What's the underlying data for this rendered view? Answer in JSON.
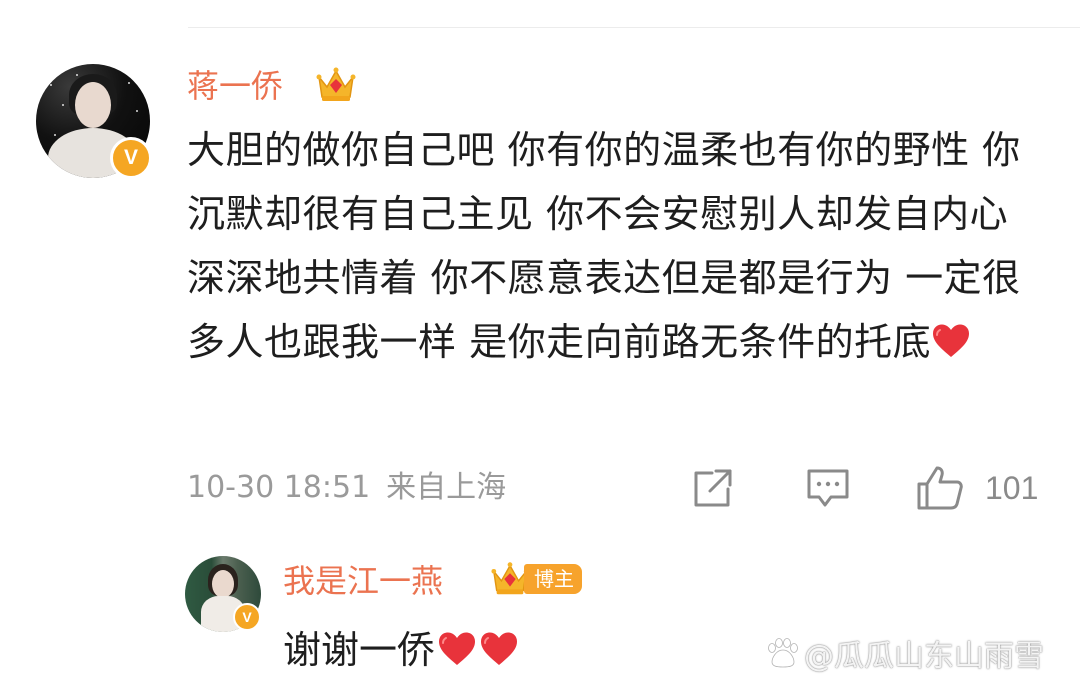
{
  "comment": {
    "username": "蒋一侨",
    "avatar_badge": "V",
    "text": "大胆的做你自己吧 你有你的温柔也有你的野性 你沉默却很有自己主见 你不会安慰别人却发自内心深深地共情着 你不愿意表达但是都是行为 一定很多人也跟我一样 是你走向前路无条件的托底",
    "time": "10-30 18:51",
    "location": "来自上海",
    "like_count": "101",
    "icons": [
      "crown-icon",
      "heart-icon",
      "share-icon",
      "comment-icon",
      "like-icon"
    ]
  },
  "reply": {
    "username": "我是江一燕",
    "avatar_badge": "V",
    "badge_label": "博主",
    "text": "谢谢一侨"
  },
  "watermark": {
    "text": "@瓜瓜山东山雨雪"
  },
  "colors": {
    "username": "#eb7350",
    "badge": "#f7a32c",
    "heart": "#e8333b",
    "meta": "#9a9a9a",
    "text": "#1e1e1e"
  }
}
